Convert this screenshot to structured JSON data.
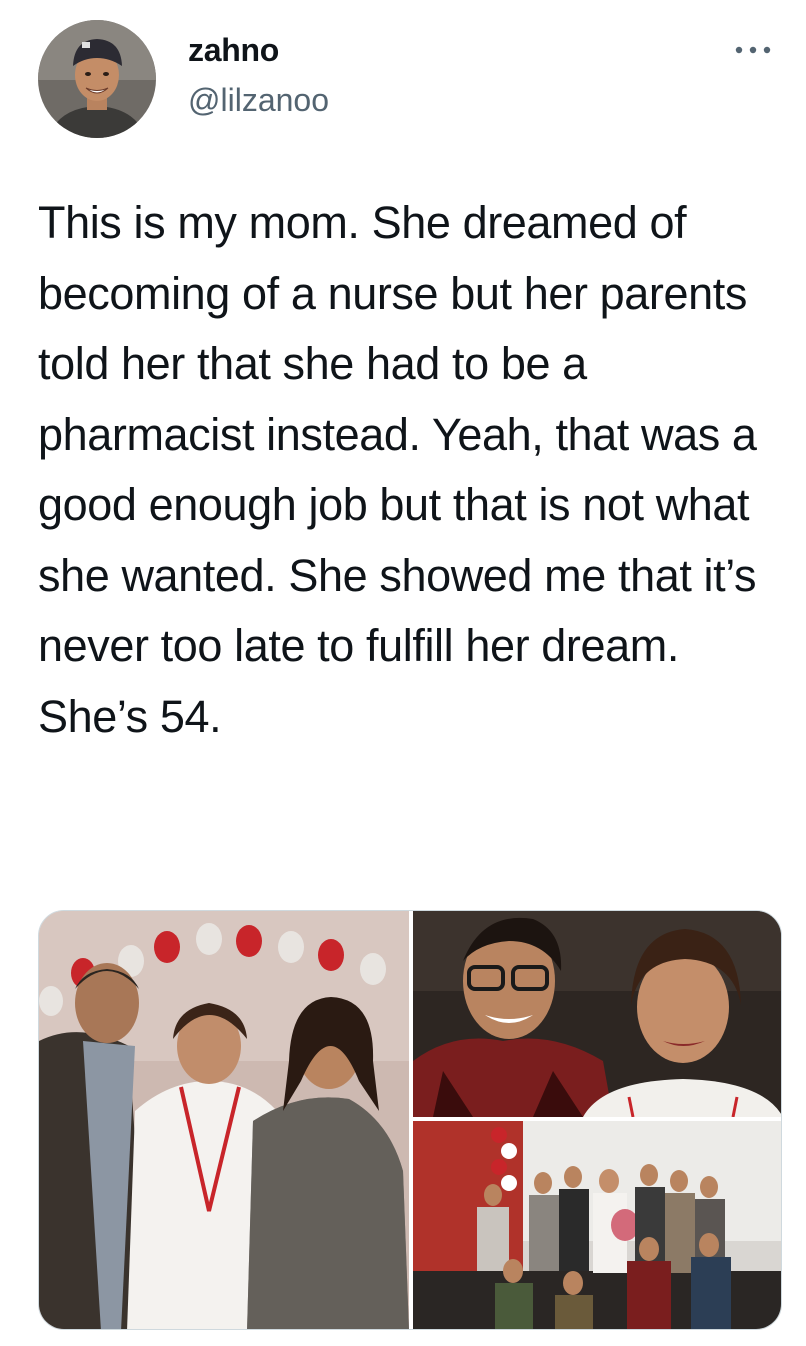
{
  "author": {
    "display_name": "zahno",
    "handle": "@lilzanoo",
    "avatar_icon": "profile-photo"
  },
  "more_icon": "more-horizontal-icon",
  "tweet": {
    "text": "This is my mom. She dreamed of becoming of a nurse but her parents told her that she had to be a pharmacist instead. Yeah, that was a good enough job but that is not what she wanted. She showed me that it’s never too late to fulfill her dream. She’s 54."
  },
  "media": {
    "photo_count": 3
  },
  "colors": {
    "text": "#0f1419",
    "secondary_text": "#536471",
    "border": "#cfd9de",
    "balloon_red": "#c8252a",
    "balloon_white": "#e8e4e0"
  }
}
